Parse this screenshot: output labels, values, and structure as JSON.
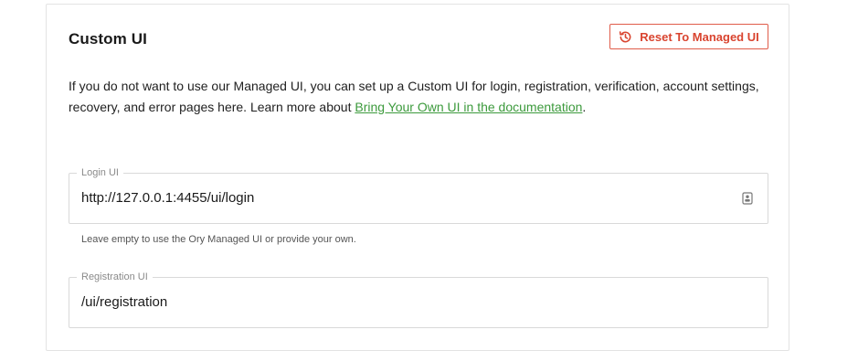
{
  "section": {
    "title": "Custom UI",
    "reset_button_label": "Reset To Managed UI",
    "description_text": "If you do not want to use our Managed UI, you can set up a Custom UI for login, registration, verification, account settings, recovery, and error pages here. Learn more about ",
    "description_link": "Bring Your Own UI in the documentation",
    "description_end": "."
  },
  "fields": {
    "login": {
      "label": "Login UI",
      "value": "http://127.0.0.1:4455/ui/login",
      "helper": "Leave empty to use the Ory Managed UI or provide your own.",
      "icon": "contact-card-icon"
    },
    "registration": {
      "label": "Registration UI",
      "value": "/ui/registration"
    }
  },
  "colors": {
    "accent_red": "#d9442f",
    "link_green": "#3c9a3c"
  }
}
